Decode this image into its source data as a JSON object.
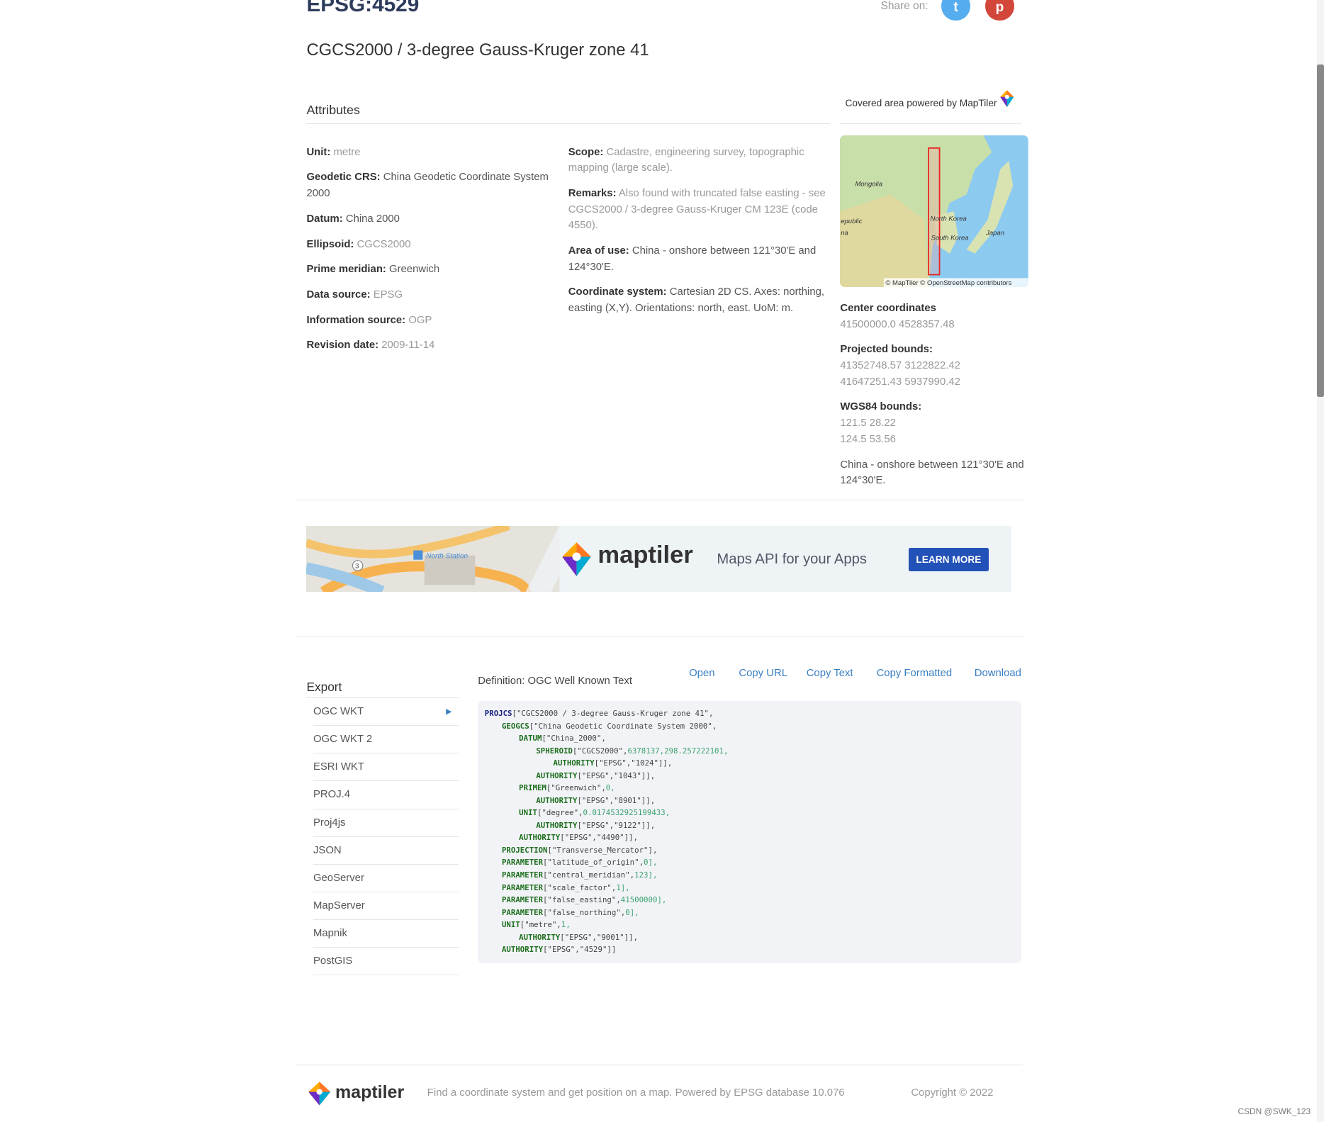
{
  "header": {
    "code": "EPSG:4529",
    "title": "CGCS2000 / 3-degree Gauss-Kruger zone 41",
    "share_label": "Share on:",
    "twitter_icon": "twitter-icon",
    "pinterest_icon": "pinterest-icon"
  },
  "attributes": {
    "heading": "Attributes",
    "left": [
      {
        "label": "Unit:",
        "value": "metre"
      },
      {
        "label": "Geodetic CRS:",
        "value": "China Geodetic Coordinate System 2000"
      },
      {
        "label": "Datum:",
        "value": "China 2000"
      },
      {
        "label": "Ellipsoid:",
        "value": "CGCS2000"
      },
      {
        "label": "Prime meridian:",
        "value": "Greenwich"
      },
      {
        "label": "Data source:",
        "value": "EPSG"
      },
      {
        "label": "Information source:",
        "value": "OGP"
      },
      {
        "label": "Revision date:",
        "value": "2009-11-14"
      }
    ],
    "middle": [
      {
        "label": "Scope:",
        "value": "Cadastre, engineering survey, topographic mapping (large scale)."
      },
      {
        "label": "Remarks:",
        "value": "Also found with truncated false easting - see CGCS2000 / 3-degree Gauss-Kruger CM 123E (code 4550)."
      },
      {
        "label": "Area of use:",
        "value": "China - onshore between 121°30'E and 124°30'E."
      },
      {
        "label": "Coordinate system:",
        "value": "Cartesian 2D CS. Axes: northing, easting (X,Y). Orientations: north, east. UoM: m."
      }
    ]
  },
  "map": {
    "covered_label": "Covered area powered by MapTiler",
    "labels": [
      "Mongolia",
      "epublic",
      "na",
      "North Korea",
      "South Korea",
      "Japan"
    ],
    "attribution": "© MapTiler © OpenStreetMap contributors",
    "center_label": "Center coordinates",
    "center": "41500000.0 4528357.48",
    "projected_label": "Projected bounds:",
    "projected": [
      "41352748.57 3122822.42",
      "41647251.43 5937990.42"
    ],
    "wgs_label": "WGS84 bounds:",
    "wgs": [
      "121.5 28.22",
      "124.5 53.56"
    ],
    "area": "China - onshore between 121°30'E and 124°30'E."
  },
  "ad": {
    "brand": "maptiler",
    "tagline": "Maps API for your Apps",
    "button": "LEARN MORE",
    "map_label": "North Station",
    "road_number": "3"
  },
  "export": {
    "heading": "Export",
    "definition": "Definition: OGC Well Known Text",
    "actions": [
      "Open",
      "Copy URL",
      "Copy Text",
      "Copy Formatted",
      "Download"
    ],
    "formats": [
      "OGC WKT",
      "OGC WKT 2",
      "ESRI WKT",
      "PROJ.4",
      "Proj4js",
      "JSON",
      "GeoServer",
      "MapServer",
      "Mapnik",
      "PostGIS"
    ],
    "selected": "OGC WKT",
    "wkt": [
      [
        0,
        "PROJCS",
        "[\"CGCS2000 / 3-degree Gauss-Kruger zone 41\",",
        ""
      ],
      [
        1,
        "GEOGCS",
        "[\"China Geodetic Coordinate System 2000\",",
        ""
      ],
      [
        2,
        "DATUM",
        "[\"China_2000\",",
        ""
      ],
      [
        3,
        "SPHEROID",
        "[\"CGCS2000\",",
        "6378137,298.257222101,"
      ],
      [
        4,
        "AUTHORITY",
        "[\"EPSG\",\"1024\"]],",
        ""
      ],
      [
        3,
        "AUTHORITY",
        "[\"EPSG\",\"1043\"]],",
        ""
      ],
      [
        2,
        "PRIMEM",
        "[\"Greenwich\",",
        "0,"
      ],
      [
        3,
        "AUTHORITY",
        "[\"EPSG\",\"8901\"]],",
        ""
      ],
      [
        2,
        "UNIT",
        "[\"degree\",",
        "0.0174532925199433,"
      ],
      [
        3,
        "AUTHORITY",
        "[\"EPSG\",\"9122\"]],",
        ""
      ],
      [
        2,
        "AUTHORITY",
        "[\"EPSG\",\"4490\"]],",
        ""
      ],
      [
        1,
        "PROJECTION",
        "[\"Transverse_Mercator\"],",
        ""
      ],
      [
        1,
        "PARAMETER",
        "[\"latitude_of_origin\",",
        "0],"
      ],
      [
        1,
        "PARAMETER",
        "[\"central_meridian\",",
        "123],"
      ],
      [
        1,
        "PARAMETER",
        "[\"scale_factor\",",
        "1],"
      ],
      [
        1,
        "PARAMETER",
        "[\"false_easting\",",
        "41500000],"
      ],
      [
        1,
        "PARAMETER",
        "[\"false_northing\",",
        "0],"
      ],
      [
        1,
        "UNIT",
        "[\"metre\",",
        "1,"
      ],
      [
        2,
        "AUTHORITY",
        "[\"EPSG\",\"9001\"]],",
        ""
      ],
      [
        1,
        "AUTHORITY",
        "[\"EPSG\",\"4529\"]]",
        ""
      ]
    ]
  },
  "footer": {
    "brand": "maptiler",
    "text": "Find a coordinate system and get position on a map. Powered by EPSG database 10.076",
    "copyright": "Copyright © 2022"
  },
  "watermark": "CSDN @SWK_123",
  "colors": {
    "title": "#2d3c5c",
    "link": "#3a7fc1",
    "button": "#2251b8",
    "twitter": "#55acee",
    "pinterest": "#cb2027"
  }
}
